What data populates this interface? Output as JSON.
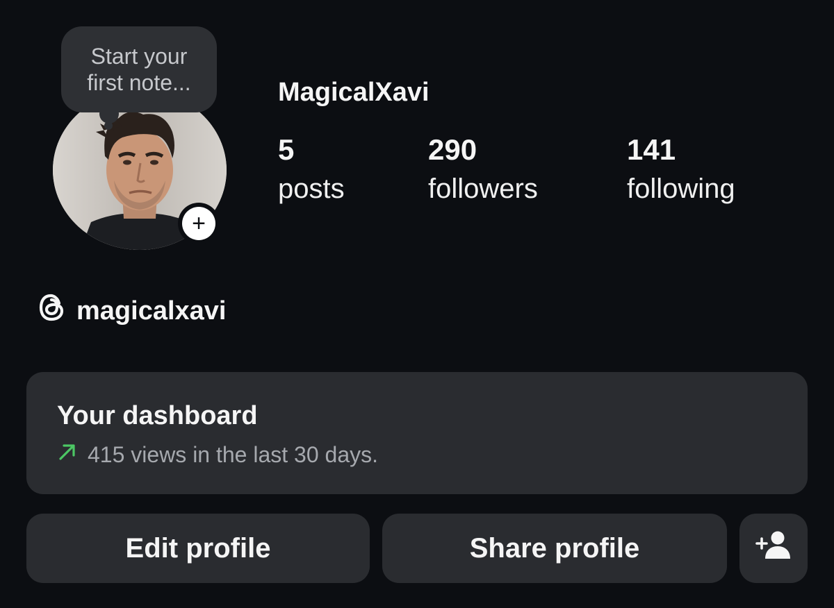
{
  "profile": {
    "note_placeholder_line1": "Start your",
    "note_placeholder_line2": "first note...",
    "username": "MagicalXavi",
    "threads_handle": "magicalxavi",
    "add_note_symbol": "+"
  },
  "stats": {
    "posts": {
      "value": "5",
      "label": "posts"
    },
    "followers": {
      "value": "290",
      "label": "followers"
    },
    "following": {
      "value": "141",
      "label": "following"
    }
  },
  "dashboard": {
    "title": "Your dashboard",
    "subtitle": "415 views in the last 30 days.",
    "trend_color": "#4cc764"
  },
  "actions": {
    "edit_label": "Edit profile",
    "share_label": "Share profile",
    "suggest_icon": "add-person-icon"
  },
  "icons": {
    "threads": "threads-logo-icon",
    "trend": "arrow-up-right-icon"
  },
  "colors": {
    "background": "#0c0e12",
    "card": "#2a2c30",
    "text": "#f5f5f5",
    "muted": "#a6a9ae"
  }
}
